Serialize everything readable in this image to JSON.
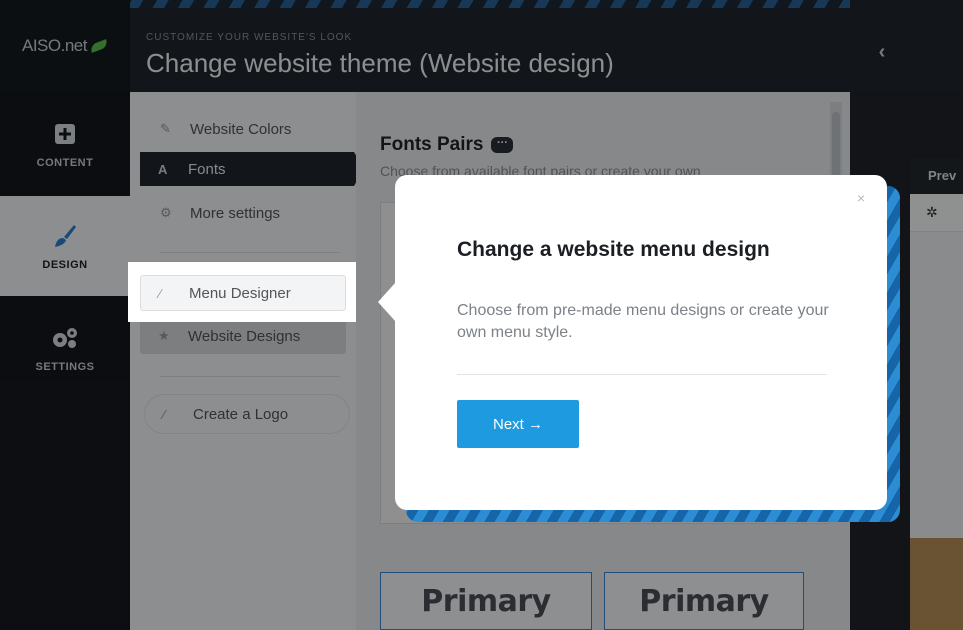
{
  "header": {
    "logo_text": "AISO.net",
    "subtitle": "CUSTOMIZE YOUR WEBSITE'S LOOK",
    "title": "Change website theme (Website design)",
    "collapse_icon": "chevron-left-icon"
  },
  "nav": {
    "items": [
      {
        "label": "CONTENT",
        "icon": "plus-square-icon"
      },
      {
        "label": "DESIGN",
        "icon": "brush-icon"
      },
      {
        "label": "SETTINGS",
        "icon": "gears-icon"
      }
    ]
  },
  "submenu": {
    "items": [
      {
        "label": "Website Colors",
        "icon": "brush-icon"
      },
      {
        "label": "Fonts",
        "icon": "font-icon"
      },
      {
        "label": "More settings",
        "icon": "gears-icon"
      },
      {
        "label": "Menu Designer",
        "icon": "magic-wand-icon"
      },
      {
        "label": "Website Designs",
        "icon": "star-icon"
      },
      {
        "label": "Create a Logo",
        "icon": "magic-wand-icon"
      }
    ]
  },
  "main": {
    "heading": "Fonts Pairs",
    "description": "Choose from available font pairs or create your own",
    "font_samples": [
      "Primary",
      "Primary"
    ]
  },
  "preview": {
    "tab_label": "Prev"
  },
  "popover": {
    "title": "Change a website menu design",
    "description": "Choose from pre-made menu designs or create your own menu style.",
    "next_label": "Next →",
    "close_label": "×"
  },
  "colors": {
    "accent": "#1e9be0",
    "nav_bg": "#14181d",
    "panel_bg": "#f3f4f6"
  }
}
